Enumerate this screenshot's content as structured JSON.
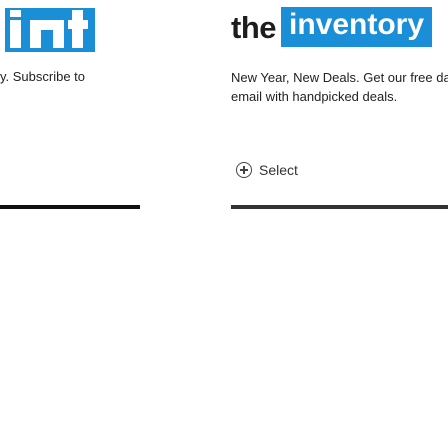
{
  "left_card": {
    "description": "y. Subscribe to",
    "logo_icon": "inventory-logo-fragment-icon"
  },
  "right_card": {
    "logo": {
      "prefix": "the",
      "boxed": "inventory"
    },
    "description": "New Year, New Deals. Get our free daily email with handpicked deals.",
    "select_label": "Select",
    "select_icon": "plus-circle-icon"
  },
  "colors": {
    "brand_blue": "#1b8ed8",
    "text": "#222222",
    "bar_left": "#111111",
    "bar_right": "#333333"
  }
}
